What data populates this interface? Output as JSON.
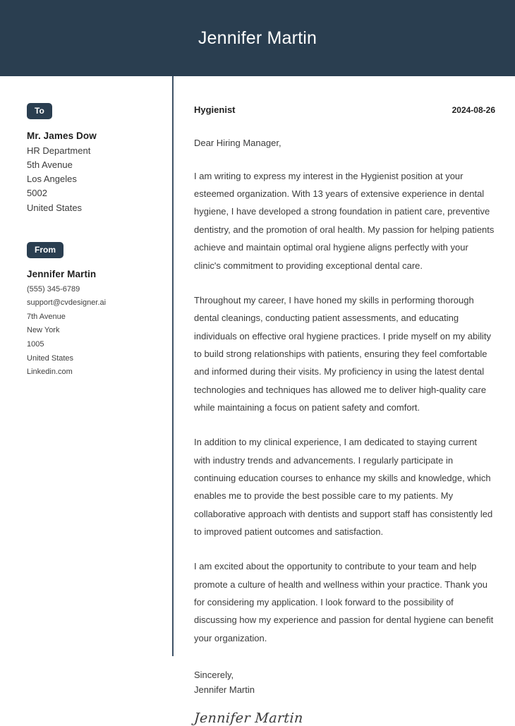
{
  "header": {
    "title": "Jennifer Martin"
  },
  "colors": {
    "header_background": "#2a3e50",
    "badge_background": "#2a3e50",
    "divider": "#3e5266",
    "body_text": "#3b3b3b",
    "heading_text": "#1f1f1f",
    "page_background": "#ffffff"
  },
  "sidebar": {
    "to": {
      "badge_label": "To",
      "name": "Mr. James Dow",
      "lines": [
        "HR Department",
        "5th Avenue",
        "Los Angeles",
        "5002",
        "United States"
      ]
    },
    "from": {
      "badge_label": "From",
      "name": "Jennifer Martin",
      "lines": [
        "(555) 345-6789",
        "support@cvdesigner.ai",
        "7th Avenue",
        "New York",
        "1005",
        "United States",
        "Linkedin.com"
      ]
    }
  },
  "letter": {
    "job_title": "Hygienist",
    "date": "2024-08-26",
    "salutation": "Dear Hiring Manager,",
    "paragraphs": [
      "I am writing to express my interest in the Hygienist position at your esteemed organization. With 13 years of extensive experience in dental hygiene, I have developed a strong foundation in patient care, preventive dentistry, and the promotion of oral health. My passion for helping patients achieve and maintain optimal oral hygiene aligns perfectly with your clinic's commitment to providing exceptional dental care.",
      "Throughout my career, I have honed my skills in performing thorough dental cleanings, conducting patient assessments, and educating individuals on effective oral hygiene practices. I pride myself on my ability to build strong relationships with patients, ensuring they feel comfortable and informed during their visits. My proficiency in using the latest dental technologies and techniques has allowed me to deliver high-quality care while maintaining a focus on patient safety and comfort.",
      "In addition to my clinical experience, I am dedicated to staying current with industry trends and advancements. I regularly participate in continuing education courses to enhance my skills and knowledge, which enables me to provide the best possible care to my patients. My collaborative approach with dentists and support staff has consistently led to improved patient outcomes and satisfaction.",
      "I am excited about the opportunity to contribute to your team and help promote a culture of health and wellness within your practice. Thank you for considering my application. I look forward to the possibility of discussing how my experience and passion for dental hygiene can benefit your organization."
    ],
    "closing": "Sincerely,",
    "closing_name": "Jennifer Martin",
    "signature": "Jennifer Martin"
  }
}
